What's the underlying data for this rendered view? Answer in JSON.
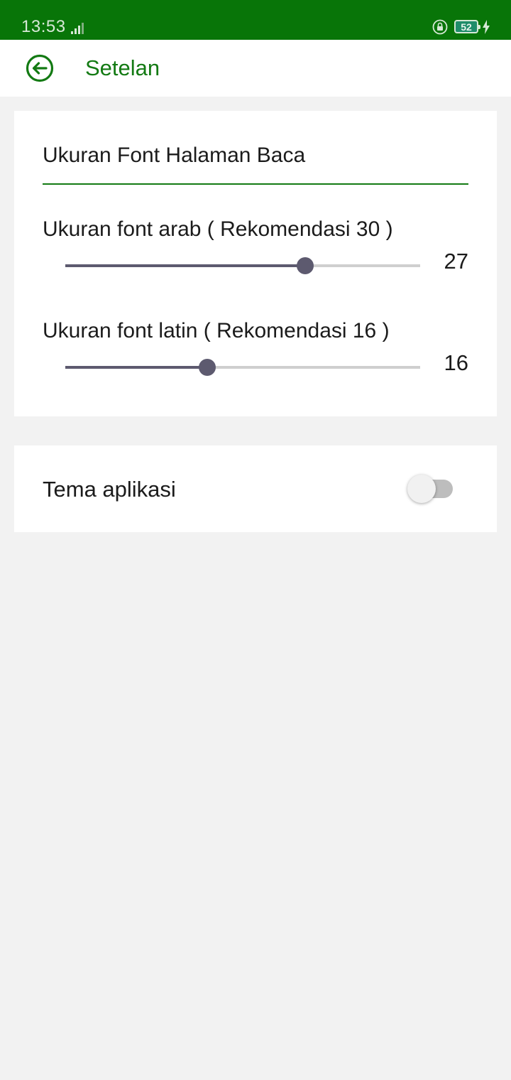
{
  "status_bar": {
    "time": "13:53",
    "battery_level": "52",
    "icons": [
      "signal-icon",
      "rotation-lock-icon",
      "battery-icon",
      "charging-bolt-icon"
    ]
  },
  "app_bar": {
    "title": "Setelan",
    "back_icon": "back-arrow-circle-icon"
  },
  "font_settings": {
    "title": "Ukuran Font Halaman Baca",
    "arabic": {
      "label": "Ukuran font arab ( Rekomendasi 30 )",
      "value": "27",
      "slider_fraction": 0.675
    },
    "latin": {
      "label": "Ukuran font latin ( Rekomendasi 16 )",
      "value": "16",
      "slider_fraction": 0.4
    }
  },
  "theme_settings": {
    "label": "Tema aplikasi",
    "enabled": false
  },
  "colors": {
    "status_bar": "#087508",
    "accent_green": "#137a13",
    "slider_active": "#5d5a6f",
    "slider_inactive": "#cfcfcf",
    "background": "#f2f2f2"
  }
}
